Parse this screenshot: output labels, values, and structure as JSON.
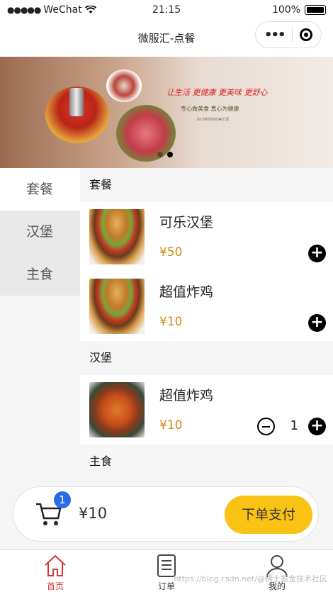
{
  "status_bar": {
    "carrier": "WeChat",
    "signal_dots": "●●●●●",
    "time": "21:15",
    "battery": "100%"
  },
  "nav": {
    "title": "微服汇-点餐",
    "more_icon": "more-dots-icon",
    "close_icon": "target-circle-icon"
  },
  "banner": {
    "slogan": "让生活 更健康 更美味 更舒心",
    "sub": "专心做美食  真心为健康",
    "sub2": "四川味佳好有美乐源",
    "indicators": 2,
    "active_indicator": 1
  },
  "sidebar": {
    "items": [
      {
        "label": "套餐"
      },
      {
        "label": "汉堡"
      },
      {
        "label": "主食"
      }
    ],
    "active_index": 0
  },
  "sections": [
    {
      "title": "套餐",
      "items": [
        {
          "name": "可乐汉堡",
          "price": "¥50"
        },
        {
          "name": "超值炸鸡",
          "price": "¥10"
        }
      ]
    },
    {
      "title": "汉堡",
      "items": [
        {
          "name": "超值炸鸡",
          "price": "¥10",
          "qty": "1"
        }
      ]
    },
    {
      "title": "主食"
    }
  ],
  "cart": {
    "badge": "1",
    "total": "¥10",
    "pay_label": "下单支付"
  },
  "tabs": [
    {
      "label": "首页"
    },
    {
      "label": "订单"
    },
    {
      "label": "我的"
    }
  ],
  "watermark": "https://blog.csdn.net/@稀土掘金技术社区",
  "colors": {
    "accent": "#f9c314",
    "price": "#d08a12",
    "badge": "#2b6be6",
    "active_tab": "#d23a3a"
  }
}
